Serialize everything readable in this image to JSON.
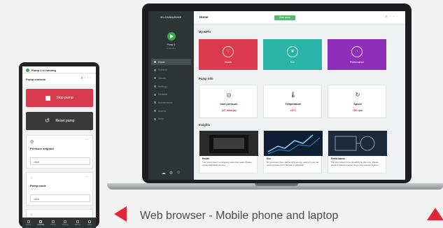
{
  "colors": {
    "brand_red": "#e32636",
    "health": "#d93a4d",
    "eco": "#2cb3a8",
    "performance": "#8d2fb8",
    "start": "#5bb870",
    "stop": "#d93a4d",
    "reset": "#3a3a3a",
    "sidebar": "#2e3436"
  },
  "laptop": {
    "brand": "ELONMARINE",
    "pump_name": "Pump 1",
    "pump_state": "is running",
    "nav": [
      "Home",
      "Schema",
      "Trends",
      "Settings",
      "Detailed",
      "Maintenance",
      "Alarms",
      "More"
    ],
    "topbar": {
      "title": "Home",
      "start_label": "Start pump",
      "icons": [
        "search-icon",
        "more-icon"
      ]
    },
    "kpi_title": "My KPI's",
    "kpis": [
      {
        "label": "Health",
        "icon": "heart-icon"
      },
      {
        "label": "Eco",
        "icon": "leaf-icon"
      },
      {
        "label": "Performance",
        "icon": "gauge-icon"
      }
    ],
    "info_title": "Pump info",
    "info": [
      {
        "label": "Inlet pressure",
        "value": "147 mbar(a)",
        "icon": "pressure-icon"
      },
      {
        "label": "Temperature",
        "value": "23°C",
        "icon": "thermometer-icon"
      },
      {
        "label": "Speed",
        "value": "750 rpm",
        "icon": "speed-icon"
      }
    ],
    "insights_title": "Insights",
    "insights": [
      {
        "title": "Health",
        "text": "Your pump had 7 emergency stops this week. Please contact Edwards service."
      },
      {
        "title": "Eco",
        "text": "Do you know there will be 10% energy saving if your set point increase from 75mbar to 100mbar!"
      },
      {
        "title": "Performance",
        "text": "The pump-down time shouldn't be this long. Please check if leaks,corrosion,clog in the vacuum system."
      }
    ]
  },
  "phone": {
    "status": "Pump 1 is running",
    "header": "Pump controls",
    "stop_label": "Stop pump",
    "reset_label": "Reset pump",
    "cards": [
      {
        "title": "Pressure setpoint",
        "field": "value"
      },
      {
        "title": "Pump mode",
        "field": "value"
      }
    ],
    "nav": [
      "Home",
      "Controls",
      "Trends",
      "Settings",
      "Alarms",
      "More"
    ]
  },
  "caption": "Web browser - Mobile phone and laptop"
}
